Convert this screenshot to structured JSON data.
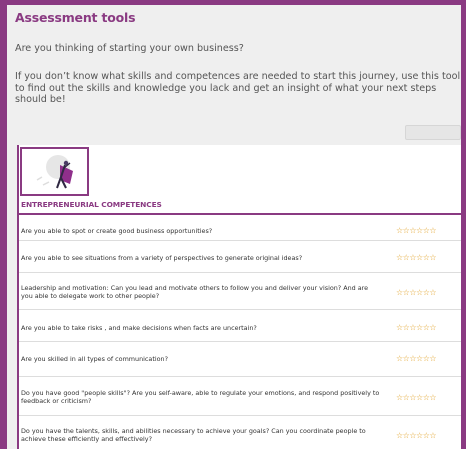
{
  "page": {
    "title": "Assessment tools",
    "intro": "Are you thinking of starting your own business?",
    "description": "If you don’t know what skills and competences are needed to start this journey, use this tool to find out the skills and knowledge you lack and get an insight of what your next steps should be!"
  },
  "section": {
    "heading": "ENTREPRENEURIAL COMPETENCES"
  },
  "rating": {
    "stars": "☆☆☆☆☆☆",
    "count": 6,
    "selected": 0
  },
  "questions": [
    "Are you able to spot or create good business opportunities?",
    "Are you able to see situations from a variety of perspectives to generate original ideas?",
    "Leadership and motivation: Can you lead and motivate others to follow you and deliver your vision? And are you able to delegate work to other people?",
    "Are you able to take risks , and make decisions when facts are uncertain?",
    "Are you skilled in all types of communication?",
    "Do you have good \"people skills\"? Are you self-aware, able to regulate your emotions, and respond positively to feedback or criticism?",
    "Do you have the talents, skills, and abilities necessary to achieve your goals? Can you coordinate people to achieve these efficiently and effectively?"
  ],
  "colors": {
    "brand": "#8a3a82",
    "star": "#e2a32a",
    "background": "#efefef"
  }
}
